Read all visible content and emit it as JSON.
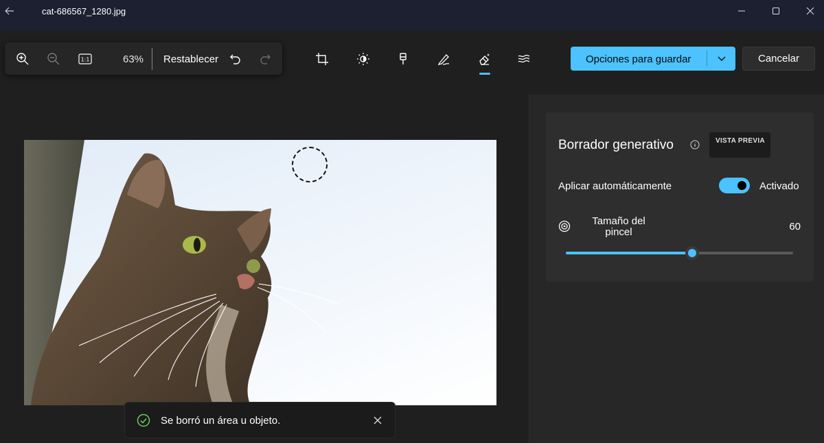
{
  "window": {
    "title": "cat-686567_1280.jpg",
    "icons": {
      "back": "back-arrow-icon",
      "minimize": "minimize-icon",
      "maximize": "maximize-icon",
      "close": "close-icon"
    }
  },
  "toolbar": {
    "zoom_value": "63%",
    "reset_label": "Restablecer",
    "actual_size_label": "1:1",
    "icons": [
      "zoom-in-icon",
      "zoom-out-icon",
      "actual-size-icon",
      "undo-icon",
      "redo-icon"
    ],
    "tools": [
      "crop-icon",
      "adjust-brightness-icon",
      "filter-icon",
      "markup-pen-icon",
      "generative-erase-icon",
      "background-blur-icon"
    ],
    "active_tool": "generative-erase-icon",
    "save_label": "Opciones para guardar",
    "cancel_label": "Cancelar",
    "accent_color": "#4cc2ff"
  },
  "canvas": {
    "image_description_name": "cat-photo",
    "brush_cursor": "brush-cursor-circle"
  },
  "panel": {
    "title": "Borrador generativo",
    "preview_badge": "VISTA PREVIA",
    "auto_apply_label": "Aplicar automáticamente",
    "auto_apply_state": "Activado",
    "auto_apply_on": true,
    "brush_size_label": "Tamaño del pincel",
    "brush_size_value": "60",
    "brush_size_fraction": 0.557
  },
  "toast": {
    "message": "Se borró un área u objeto.",
    "status_color": "#6ccb5f"
  }
}
